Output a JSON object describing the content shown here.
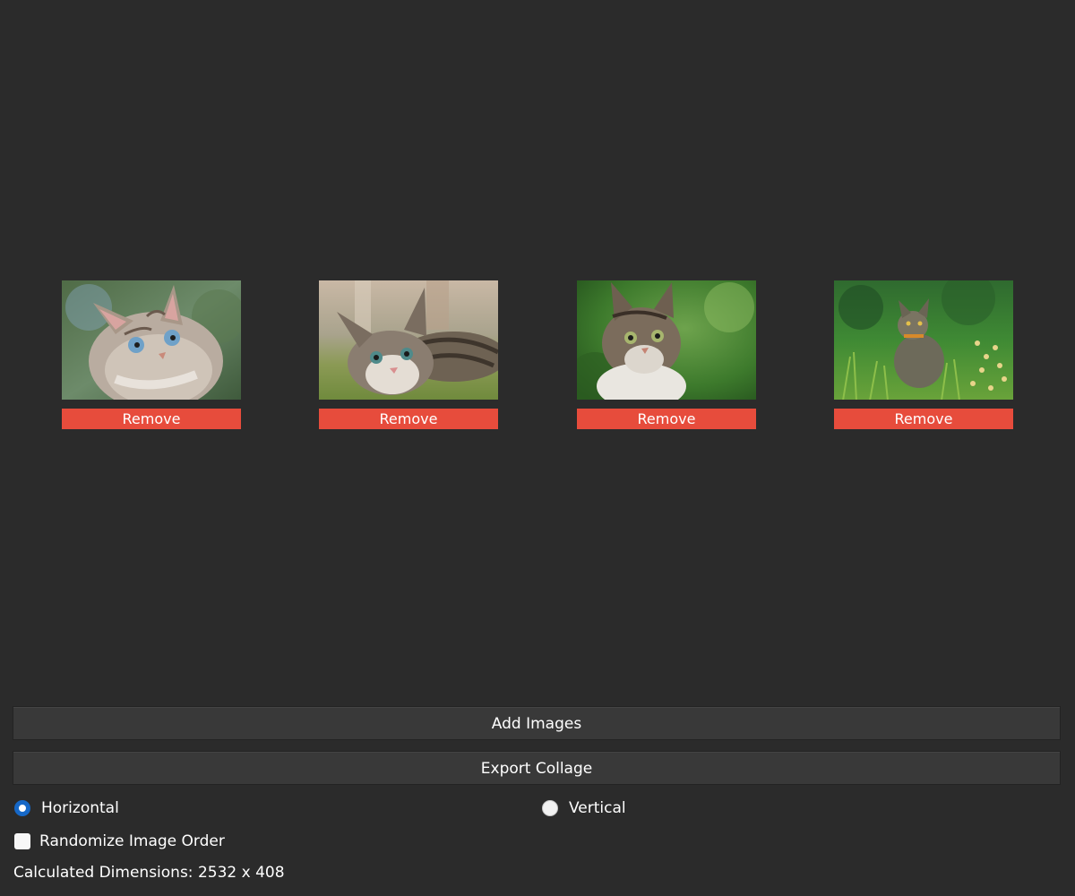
{
  "gallery": {
    "images": [
      {
        "remove_label": "Remove"
      },
      {
        "remove_label": "Remove"
      },
      {
        "remove_label": "Remove"
      },
      {
        "remove_label": "Remove"
      }
    ]
  },
  "buttons": {
    "add_images": "Add Images",
    "export_collage": "Export Collage"
  },
  "orientation": {
    "options": [
      {
        "label": "Horizontal",
        "selected": true
      },
      {
        "label": "Vertical",
        "selected": false
      }
    ]
  },
  "options": {
    "randomize_label": "Randomize Image Order",
    "randomize_checked": false
  },
  "status": {
    "dimensions_text": "Calculated Dimensions: 2532 x 408"
  },
  "colors": {
    "background": "#2b2b2b",
    "remove_button": "#e74c3c",
    "button_bg": "#393939",
    "radio_accent": "#1668c7"
  }
}
